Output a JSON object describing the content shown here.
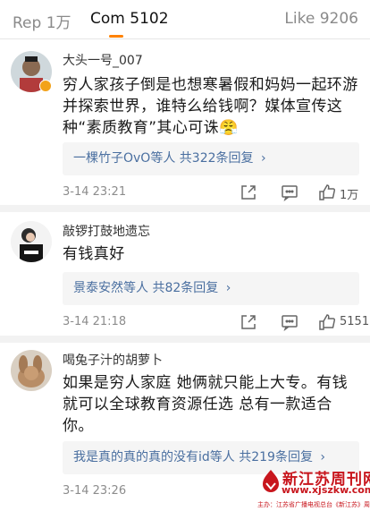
{
  "tabs": {
    "rep_label": "Rep",
    "rep_count": "1万",
    "com_label": "Com",
    "com_count": "5102",
    "like_label": "Like",
    "like_count": "9206",
    "accent_color": "#ff8200"
  },
  "comments": [
    {
      "username": "大头一号_007",
      "text": "穷人家孩子倒是也想寒暑假和妈妈一起环游并探索世界，谁特么给钱啊？媒体宣传这种“素质教育”其心可诛",
      "emoji": "😤",
      "reply_names": "一棵竹子OvO等人",
      "reply_count": "共322条回复",
      "time": "3-14 23:21",
      "like_count": "1万",
      "verified": true
    },
    {
      "username": "敲锣打鼓地遗忘",
      "text": "有钱真好",
      "reply_names": "景泰安然等人",
      "reply_count": "共82条回复",
      "time": "3-14 21:18",
      "like_count": "5151"
    },
    {
      "username": "喝兔子汁的胡萝卜",
      "text": "如果是穷人家庭 她俩就只能上大专。有钱就可以全球教育资源任选 总有一款适合你。",
      "reply_names": "我是真的真的真的没有id等人",
      "reply_count": "共219条回复",
      "time": "3-14 23:26"
    }
  ],
  "watermark": {
    "title": "新江苏周刊网",
    "url": "www.xjszkw.com",
    "sub": "主办：江苏省广播电视总台《新江苏》周刊"
  },
  "icons": {
    "share": "share-icon",
    "comment": "comment-icon",
    "like": "thumbs-up-icon",
    "reply_arrow": "chevron-right-icon"
  }
}
